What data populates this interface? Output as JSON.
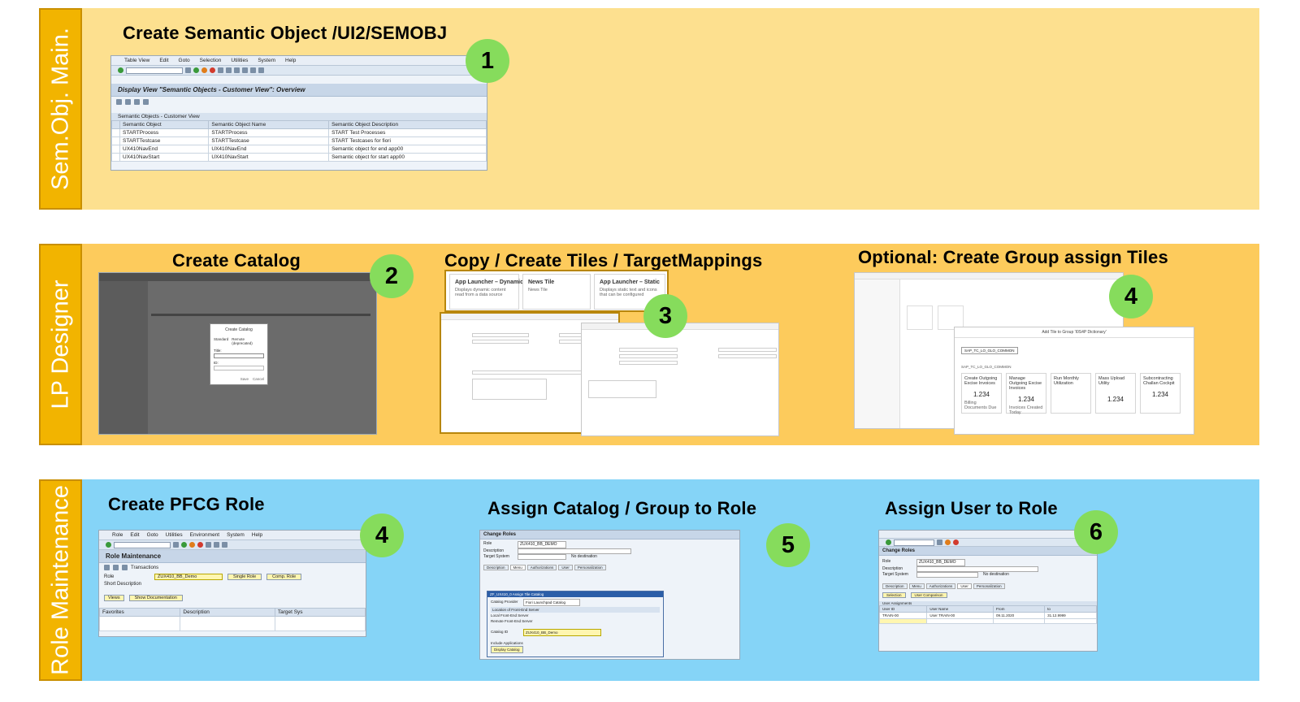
{
  "bands": [
    {
      "id": "semantic-object",
      "label": "Sem.Obj. Main.",
      "color": "#fde08f",
      "steps": [
        {
          "title": "Create Semantic Object /UI2/SEMOBJ",
          "badge": "1",
          "screenshot": {
            "menu": [
              "Table View",
              "Edit",
              "Goto",
              "Selection",
              "Utilities",
              "System",
              "Help"
            ],
            "view_title": "Display View \"Semantic Objects - Customer View\": Overview",
            "section_label": "Semantic Objects - Customer View",
            "columns": [
              "Semantic Object",
              "Semantic Object Name",
              "Semantic Object Description"
            ],
            "rows": [
              [
                "STARTProcess",
                "STARTProcess",
                "START Test Processes"
              ],
              [
                "STARTTestcase",
                "STARTTestcase",
                "START Testcases for fiori"
              ],
              [
                "UX410NavEnd",
                "UX410NavEnd",
                "Semantic object for end app00"
              ],
              [
                "UX410NavStart",
                "UX410NavStart",
                "Semantic object for start app00"
              ]
            ]
          }
        }
      ]
    },
    {
      "id": "lp-designer",
      "label": "LP Designer",
      "color": "#fdcb5c",
      "steps": [
        {
          "title": "Create Catalog",
          "badge": "2",
          "screenshot": {
            "dialog_title": "Create Catalog",
            "options": [
              "Standard",
              "Remote (deprecated)"
            ],
            "fields": [
              "Title:",
              "ID:"
            ],
            "buttons": [
              "Save",
              "Cancel"
            ]
          }
        },
        {
          "title": "Copy / Create Tiles / TargetMappings",
          "badge": "3",
          "screenshot": {
            "tiles": [
              {
                "title": "App Launcher – Dynamic",
                "subtitle": "Displays dynamic content read from a data source"
              },
              {
                "title": "News Tile",
                "subtitle": "News Tile"
              },
              {
                "title": "App Launcher – Static",
                "subtitle": "Displays static text and icons that can be configured"
              }
            ]
          }
        },
        {
          "title": "Optional: Create Group assign Tiles",
          "badge": "4",
          "screenshot": {
            "dialog_title": "Add Tile to Group 'I0S4P Dictionary'",
            "catalog_chip": "SAP_TC_LO_GLO_COMMON",
            "tiles": [
              {
                "title": "Create Outgoing Excise Invoices",
                "value": "1.234",
                "footer": "Billing Documents Due"
              },
              {
                "title": "Manage Outgoing Excise Invoices",
                "value": "1.234",
                "footer": "Invoices Created Today"
              },
              {
                "title": "Run Monthly Utilization",
                "value": "",
                "footer": ""
              },
              {
                "title": "Mass Upload Utility",
                "value": "1.234",
                "footer": ""
              },
              {
                "title": "Subcontracting Challan Cockpit",
                "value": "1.234",
                "footer": ""
              }
            ]
          }
        }
      ]
    },
    {
      "id": "role-maintenance",
      "label": "Role Maintenance",
      "color": "#85d4f7",
      "steps": [
        {
          "title": "Create PFCG Role",
          "badge": "4",
          "screenshot": {
            "menu": [
              "Role",
              "Edit",
              "Goto",
              "Utilities",
              "Environment",
              "System",
              "Help"
            ],
            "view_title": "Role Maintenance",
            "transactions": "Transactions",
            "role_label": "Role",
            "role_value": "ZUX410_BB_Demo",
            "short_desc": "Short Description",
            "buttons": [
              "Single Role",
              "Comp. Role",
              "Views",
              "Show Documentation"
            ],
            "columns": [
              "Favorites",
              "Description",
              "Target Sys"
            ]
          }
        },
        {
          "title": "Assign Catalog / Group to Role",
          "badge": "5",
          "screenshot": {
            "view_title": "Change Roles",
            "fields": [
              "Role",
              "Description",
              "Target System"
            ],
            "role_value": "ZUX410_BB_DEMO",
            "no_dest": "No destination",
            "tabs": [
              "Description",
              "Menu",
              "Authorizations",
              "User",
              "Personalization"
            ],
            "dialog_title": "ZF_UX410_0 Assign Tile Catalog",
            "catalog_provider_label": "Catalog Provider",
            "catalog_provider_value": "Fiori Launchpad Catalog",
            "location_label": "Location of Front-End Server",
            "location_options": [
              "Local Front-End Server",
              "Remote Front-End Server"
            ],
            "catalog_id_label": "Catalog ID",
            "catalog_id_value": "ZUX410_BB_Demo",
            "include_apps": "Include Applications",
            "display_btn": "Display Catalog"
          }
        },
        {
          "title": "Assign User to Role",
          "badge": "6",
          "screenshot": {
            "view_title": "Change Roles",
            "fields": [
              "Role",
              "Description",
              "Target System"
            ],
            "role_value": "ZUX410_BB_DEMO",
            "no_dest": "No destination",
            "tabs": [
              "Description",
              "Menu",
              "Authorizations",
              "User",
              "Personalization"
            ],
            "selection_btn": "Selection",
            "user_comparison_btn": "User Comparison",
            "assignments_label": "User Assignments",
            "columns": [
              "User ID",
              "User Name",
              "From",
              "to"
            ],
            "rows": [
              [
                "TRAIN-00",
                "User TRAIN-00",
                "09.11.2020",
                "31.12.9999"
              ]
            ]
          }
        }
      ]
    }
  ]
}
